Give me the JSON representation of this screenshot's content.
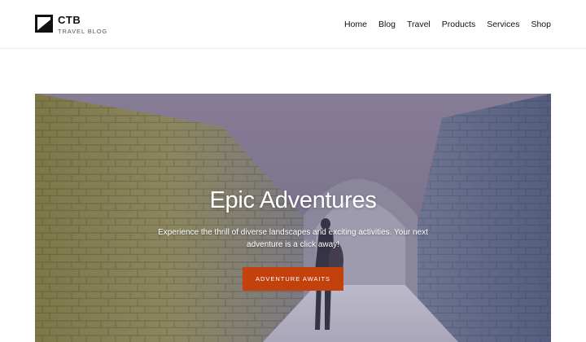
{
  "brand": {
    "name": "CTB",
    "tagline": "TRAVEL BLOG",
    "logo_icon": "ctb-logo-icon"
  },
  "nav": {
    "items": [
      {
        "label": "Home"
      },
      {
        "label": "Blog"
      },
      {
        "label": "Travel"
      },
      {
        "label": "Products"
      },
      {
        "label": "Services"
      },
      {
        "label": "Shop"
      }
    ]
  },
  "hero": {
    "title": "Epic Adventures",
    "subtitle": "Experience the thrill of diverse landscapes and exciting activities. Your next adventure is a click away!",
    "button_label": "ADVENTURE AWAITS",
    "button_color": "#c2410c"
  }
}
